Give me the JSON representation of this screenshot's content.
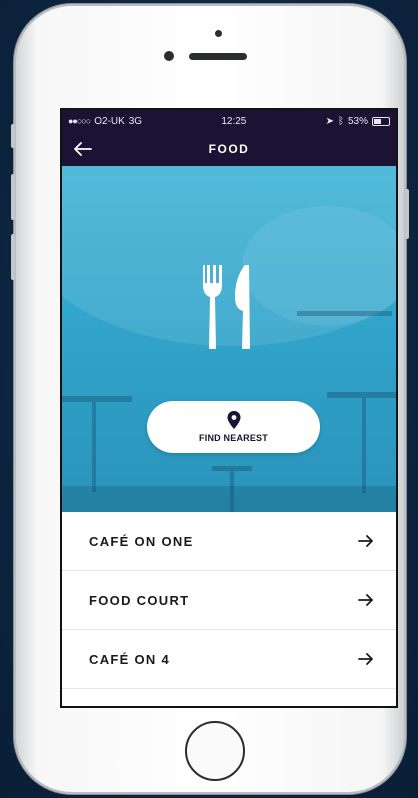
{
  "status_bar": {
    "carrier": "O2-UK",
    "network": "3G",
    "time": "12:25",
    "battery": "53%",
    "battery_level": 0.53
  },
  "nav": {
    "title": "FOOD",
    "back_icon": "back-arrow-icon"
  },
  "hero": {
    "icon": "fork-knife-icon",
    "find_button": {
      "icon": "location-pin-icon",
      "label": "FIND NEAREST"
    }
  },
  "locations": [
    {
      "label": "CAFÉ ON ONE",
      "icon": "arrow-right-icon"
    },
    {
      "label": "FOOD COURT",
      "icon": "arrow-right-icon"
    },
    {
      "label": "CAFÉ ON 4",
      "icon": "arrow-right-icon"
    }
  ],
  "colors": {
    "nav_bg": "#1c1233",
    "hero_bg": "#33a6cc",
    "background": "#0f2a44"
  }
}
